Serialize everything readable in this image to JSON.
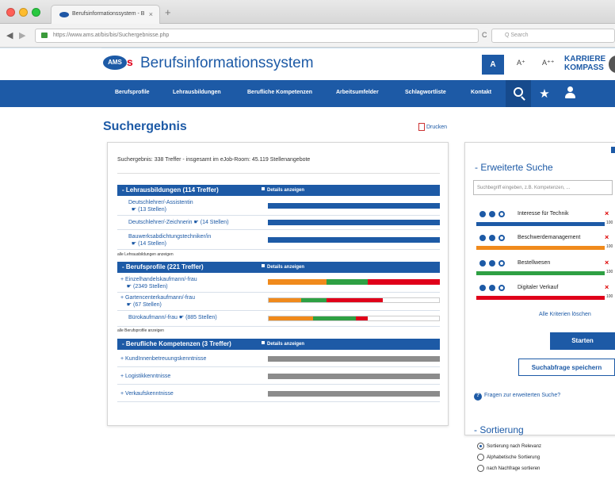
{
  "browser": {
    "tab_title": "Berufsinformationssystem - B",
    "tab_close": "×",
    "new_tab": "+",
    "url": "https://www.ams.at/bis/bis/Suchergebnisse.php",
    "search_placeholder": "Q Search",
    "back": "◀",
    "forward": "▶",
    "reload": "C"
  },
  "header": {
    "logo_text": "AMS",
    "logo_s": "s",
    "site_title": "Berufsinformationssystem",
    "font_a": "A",
    "font_a_plus": "A⁺",
    "font_a_plus2": "A⁺⁺",
    "karriere_line1": "KARRIERE",
    "karriere_line2": "KOMPASS"
  },
  "nav": {
    "items": [
      "Berufsprofile",
      "Lehrausbildungen",
      "Berufliche Kompetenzen",
      "Arbeitsumfelder",
      "Schlagwortliste",
      "Kontakt"
    ],
    "star": "★"
  },
  "main": {
    "heading": "Suchergebnis",
    "print_label": "Drucken",
    "summary": "Suchergebnis: 338 Treffer - insgesamt im eJob-Room: 45.119 Stellenangebote",
    "details_label": "Details anzeigen",
    "sections": [
      {
        "title": "- Lehrausbildungen (114 Treffer)",
        "rows": [
          {
            "name": "Deutschlehrer/-Assistentin",
            "sub": "(13 Stellen)"
          },
          {
            "name": "Deutschlehrer/-Zeichnerin",
            "sub": "(14 Stellen)"
          },
          {
            "name": "Bauwerksabdichtungstechniker/in",
            "sub": "(14 Stellen)"
          }
        ],
        "show_all": "alle Lehrausbildungen anzeigen"
      },
      {
        "title": "- Berufsprofile (221 Treffer)",
        "rows": [
          {
            "name": "+ Einzelhandelskaufmann/-frau",
            "sub": "(2349 Stellen)"
          },
          {
            "name": "+ Gartencenterkaufmann/-frau",
            "sub": "(67 Stellen)"
          },
          {
            "name": "Bürokaufmann/-frau",
            "sub": "(885 Stellen)"
          }
        ],
        "show_all": "alle Berufsprofile anzeigen"
      },
      {
        "title": "- Berufliche Kompetenzen (3 Treffer)",
        "rows": [
          {
            "name": "+ KundInnenbetreuungskenntnisse"
          },
          {
            "name": "+ Logistikkenntnisse"
          },
          {
            "name": "+ Verkaufskenntnisse"
          }
        ]
      }
    ]
  },
  "sidebar": {
    "title": "- Erweiterte Suche",
    "input_placeholder": "Suchbegriff eingeben, z.B. Kompetenzen, ...",
    "criteria": [
      {
        "label": "Interesse für Technik",
        "pct": "100",
        "color": "#1d5aa6"
      },
      {
        "label": "Beschwerdemanagement",
        "pct": "100",
        "color": "#f08a1c"
      },
      {
        "label": "Bestellwesen",
        "pct": "100",
        "color": "#2ea043"
      },
      {
        "label": "Digitaler Verkauf",
        "pct": "100",
        "color": "#e0001a"
      }
    ],
    "remove": "×",
    "clear_all": "Alle Kriterien löschen",
    "start_button": "Starten",
    "save_button": "Suchabfrage speichern",
    "help_text": "Fragen zur erweiterten Suche?",
    "help_icon": "?"
  },
  "sort": {
    "title": "- Sortierung",
    "options": [
      "Sortierung nach Relevanz",
      "Alphabetische Sortierung",
      "nach Nachfrage sortieren"
    ],
    "selected": 0
  },
  "colors": {
    "brand_blue": "#1d5aa6",
    "brand_red": "#e0001a",
    "orange": "#f08a1c",
    "green": "#2ea043",
    "gray_bar": "#8c8c8c"
  }
}
